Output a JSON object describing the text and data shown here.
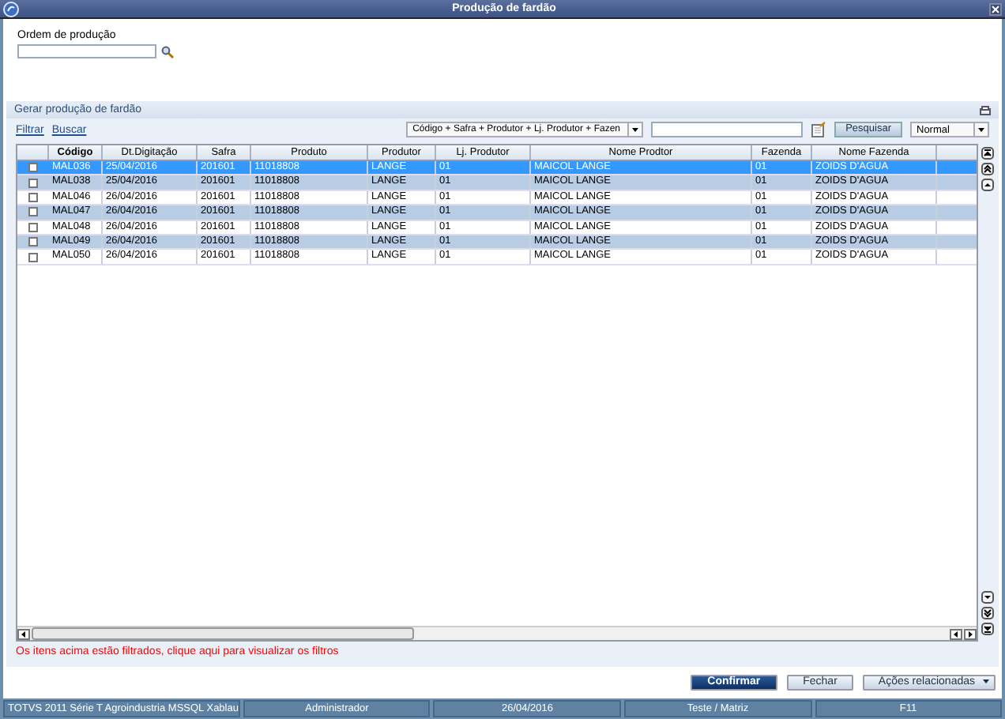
{
  "window": {
    "title": "Produção de fardão"
  },
  "order_field": {
    "label": "Ordem de produção"
  },
  "panel": {
    "title": "Gerar produção de fardão"
  },
  "toolbar": {
    "links": [
      "Filtrar",
      "Buscar"
    ],
    "index_select": "Código + Safra + Produtor + Lj. Produtor + Fazen",
    "search_button": "Pesquisar",
    "view_select": "Normal"
  },
  "table": {
    "columns": [
      "Código",
      "Dt.Digitação",
      "Safra",
      "Produto",
      "Produtor",
      "Lj. Produtor",
      "Nome Prodtor",
      "Fazenda",
      "Nome Fazenda"
    ],
    "rows": [
      {
        "selected": true,
        "checked": false,
        "cells": [
          "MAL036",
          "25/04/2016",
          "201601",
          "11018808",
          "LANGE",
          "01",
          "MAICOL LANGE",
          "01",
          "ZOIDS D'AGUA"
        ]
      },
      {
        "selected": false,
        "checked": false,
        "cells": [
          "MAL038",
          "25/04/2016",
          "201601",
          "11018808",
          "LANGE",
          "01",
          "MAICOL LANGE",
          "01",
          "ZOIDS D'AGUA"
        ]
      },
      {
        "selected": false,
        "checked": false,
        "cells": [
          "MAL046",
          "26/04/2016",
          "201601",
          "11018808",
          "LANGE",
          "01",
          "MAICOL LANGE",
          "01",
          "ZOIDS D'AGUA"
        ]
      },
      {
        "selected": false,
        "checked": false,
        "cells": [
          "MAL047",
          "26/04/2016",
          "201601",
          "11018808",
          "LANGE",
          "01",
          "MAICOL LANGE",
          "01",
          "ZOIDS D'AGUA"
        ]
      },
      {
        "selected": false,
        "checked": false,
        "cells": [
          "MAL048",
          "26/04/2016",
          "201601",
          "11018808",
          "LANGE",
          "01",
          "MAICOL LANGE",
          "01",
          "ZOIDS D'AGUA"
        ]
      },
      {
        "selected": false,
        "checked": false,
        "cells": [
          "MAL049",
          "26/04/2016",
          "201601",
          "11018808",
          "LANGE",
          "01",
          "MAICOL LANGE",
          "01",
          "ZOIDS D'AGUA"
        ]
      },
      {
        "selected": false,
        "checked": false,
        "cells": [
          "MAL050",
          "26/04/2016",
          "201601",
          "11018808",
          "LANGE",
          "01",
          "MAICOL LANGE",
          "01",
          "ZOIDS D'AGUA"
        ]
      }
    ]
  },
  "filter_message": "Os itens acima estão filtrados, clique aqui para visualizar os filtros",
  "buttons": [
    {
      "kind": "primary",
      "label": "Confirmar"
    },
    {
      "kind": "secondary",
      "label": "Fechar"
    },
    {
      "kind": "menu",
      "label": "Ações relacionadas"
    }
  ],
  "status_bar": [
    "TOTVS 2011 Série T Agroindustria MSSQL Xablau",
    "Administrador",
    "26/04/2016",
    "Teste / Matriz",
    "F11"
  ]
}
